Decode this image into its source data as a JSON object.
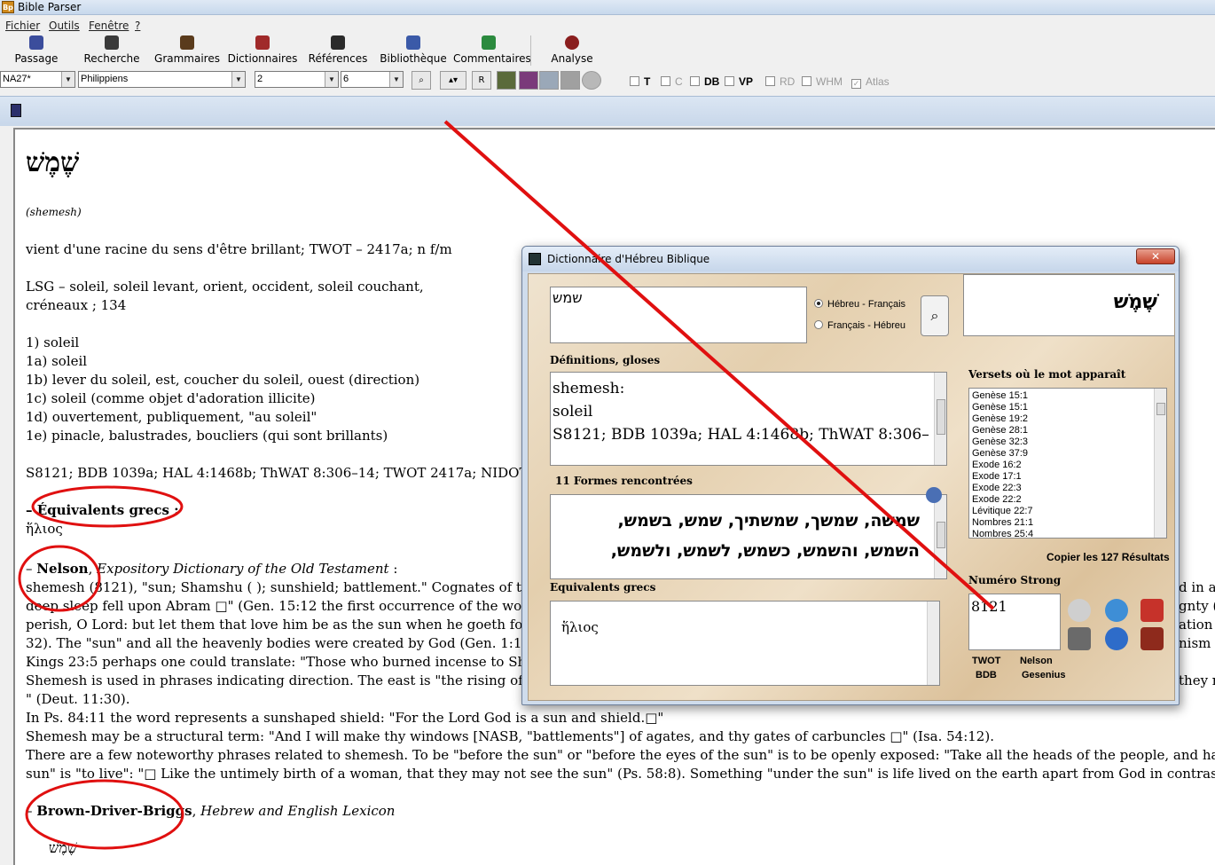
{
  "app": {
    "title": "Bible Parser",
    "icon_text": "Bp"
  },
  "menu": [
    "Fichier",
    "Outils",
    "Fenêtre",
    "?"
  ],
  "toolbar": [
    {
      "label": "Passage",
      "icon": "passage-icon",
      "color": "#3b4d9c"
    },
    {
      "label": "Recherche",
      "icon": "search-icon",
      "color": "#3a3a3a"
    },
    {
      "label": "Grammaires",
      "icon": "grammar-icon",
      "color": "#5a3b1c"
    },
    {
      "label": "Dictionnaires",
      "icon": "dictionary-icon",
      "color": "#a02a2a"
    },
    {
      "label": "Références",
      "icon": "references-icon",
      "color": "#2a2a2a"
    },
    {
      "label": "Bibliothèque",
      "icon": "library-icon",
      "color": "#3b5aa8"
    },
    {
      "label": "Commentaires",
      "icon": "comments-icon",
      "color": "#2b8a3e"
    },
    {
      "label": "Analyse",
      "icon": "analyse-icon",
      "color": "#8a1e1e"
    }
  ],
  "selectors": {
    "version": "NA27*",
    "book": "Philippiens",
    "chapter": "2",
    "verse": "6",
    "r_button": "R"
  },
  "options": [
    {
      "label": "T",
      "enabled": true,
      "checked": false
    },
    {
      "label": "C",
      "enabled": false,
      "checked": false
    },
    {
      "label": "DB",
      "enabled": true,
      "checked": false
    },
    {
      "label": "VP",
      "enabled": true,
      "checked": false
    },
    {
      "label": "RD",
      "enabled": false,
      "checked": false
    },
    {
      "label": "WHM",
      "enabled": false,
      "checked": false
    },
    {
      "label": "Atlas",
      "enabled": false,
      "checked": true
    }
  ],
  "document": {
    "hebrew_word": "שֶׁמֶשׁ",
    "transliteration": "(shemesh)",
    "root_line": "vient d'une racine du sens d'être brillant; TWOT – 2417a; n f/m",
    "lsg_line1": "LSG – soleil, soleil levant, orient, occident, soleil couchant,",
    "lsg_line2": "créneaux ; 134",
    "senses": [
      "1) soleil",
      "1a) soleil",
      "1b) lever du soleil, est, coucher du soleil, ouest (direction)",
      "1c) soleil (comme objet d'adoration illicite)",
      "1d) ouvertement, publiquement, \"au soleil\"",
      "1e) pinacle, balustrades, boucliers (qui sont brillants)"
    ],
    "refs_line": "S8121; BDB 1039a; HAL 4:1468b; ThWAT 8:306–14; TWOT 2417a; NIDOTTE 908",
    "greek_heading": "Équivalents grecs",
    "greek_word": "ἥλιος",
    "nelson_name": "Nelson",
    "nelson_title": "Expository Dictionary of the Old Testament",
    "nelson_lines": [
      "shemesh (8121), \"sun; Shamshu ( ); sunshield; battlement.\" Cognates of this word oc",
      "deep sleep fell upon Abram □\" (Gen. 15:12 the first occurrence of the word). The \"wi",
      "perish, O Lord: but let them that love him be as the sun when he goeth forth in his m",
      "32). The \"sun\" and all the heavenly bodies were created by God (Gen. 1:16) and are s",
      "Kings 23:5 perhaps one could translate: \"Those who burned incense to Shamshu\" (cf",
      "Shemesh is used in phrases indicating direction. The east is \"the rising of the sun\": \"A",
      "\" (Deut. 11:30).",
      "In Ps. 84:11 the word represents a sunshaped shield: \"For the Lord God is a sun and shield.□\"",
      "Shemesh may be a structural term: \"And I will make thy windows [NASB, \"battlements\"] of agates, and thy gates of carbuncles □\" (Isa. 54:12).",
      "There are a few noteworthy phrases related to shemesh. To be \"before the sun\" or \"before the eyes of the sun\" is to be openly exposed: \"Take all the heads of the people, and hang them up before the Lord ag",
      "sun\" is \"to live\": \"□ Like the untimely birth of a woman, that they may not see the sun\" (Ps. 58:8). Something \"under the sun\" is life lived on the earth apart from God in contrast to life lived on earth with a"
    ],
    "right_fragments": [
      "d in al",
      "gnty (",
      "ation c",
      "nism",
      "they n"
    ],
    "bdb_name": "Brown-Driver-Briggs",
    "bdb_title": "Hebrew and English Lexicon",
    "bdb_word": "שֶׁמֶשׁ"
  },
  "dialog": {
    "title": "Dictionnaire d'Hébreu Biblique",
    "close_label": "✕",
    "search_value": "שמש",
    "radio_he_fr": "Hébreu - Français",
    "radio_fr_he": "Français - Hébreu",
    "word_display": "שֶׁמֶשׁ",
    "definitions_label": "Définitions, gloses",
    "definitions": [
      "shemesh:",
      "soleil",
      "S8121; BDB 1039a; HAL 4:1468b; ThWAT 8:306–"
    ],
    "verses_label": "Versets où le mot apparaît",
    "verses": [
      "Genèse 15:1",
      "Genèse 15:1",
      "Genèse 19:2",
      "Genèse 28:1",
      "Genèse 32:3",
      "Genèse 37:9",
      "Exode 16:2",
      "Exode 17:1",
      "Exode 22:3",
      "Exode 22:2",
      "Lévitique 22:7",
      "Nombres 21:1",
      "Nombres 25:4"
    ],
    "forms_label": "11 Formes rencontrées",
    "forms_line1": "שמשה, שמשך, שמשתיך, שמש, בשמש,",
    "forms_line2": "השמש, והשמש, כשמש, לשמש, ולשמש,",
    "copy_label": "Copier les 127 Résultats",
    "greek_label": "Equivalents grecs",
    "greek_value": "ἥλιος",
    "strong_label": "Numéro Strong",
    "strong_value": "8121",
    "links": [
      "TWOT",
      "Nelson",
      "BDB",
      "Gesenius"
    ]
  }
}
